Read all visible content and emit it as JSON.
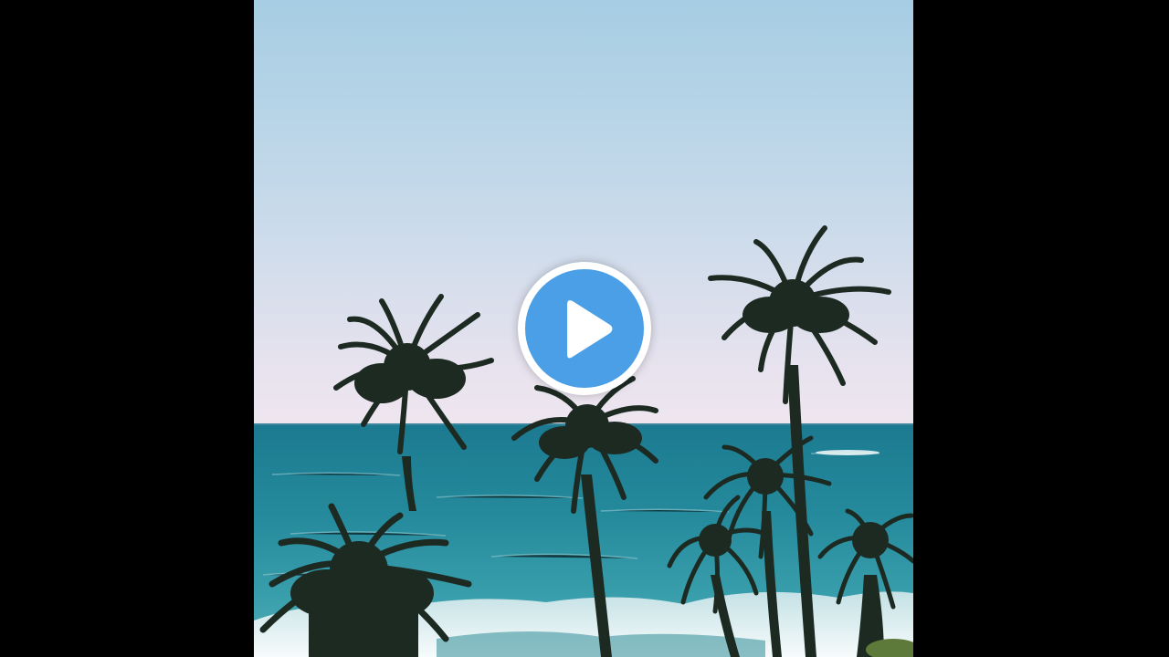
{
  "player": {
    "background_color": "#000000",
    "play_button": {
      "icon": "play-icon",
      "ring_color": "#ffffff",
      "fill_color": "#4a9fe6",
      "glyph_color": "#ffffff"
    }
  },
  "thumbnail": {
    "scene": "palm-trees-ocean-beach",
    "colors": {
      "sky_top": "#a9cfe4",
      "sky_horizon": "#ece5ef",
      "ocean_deep": "#1f7f93",
      "ocean_shallow": "#3a9aa6",
      "surf": "#dfeef0",
      "palm_foliage": "#1d2a22"
    }
  }
}
